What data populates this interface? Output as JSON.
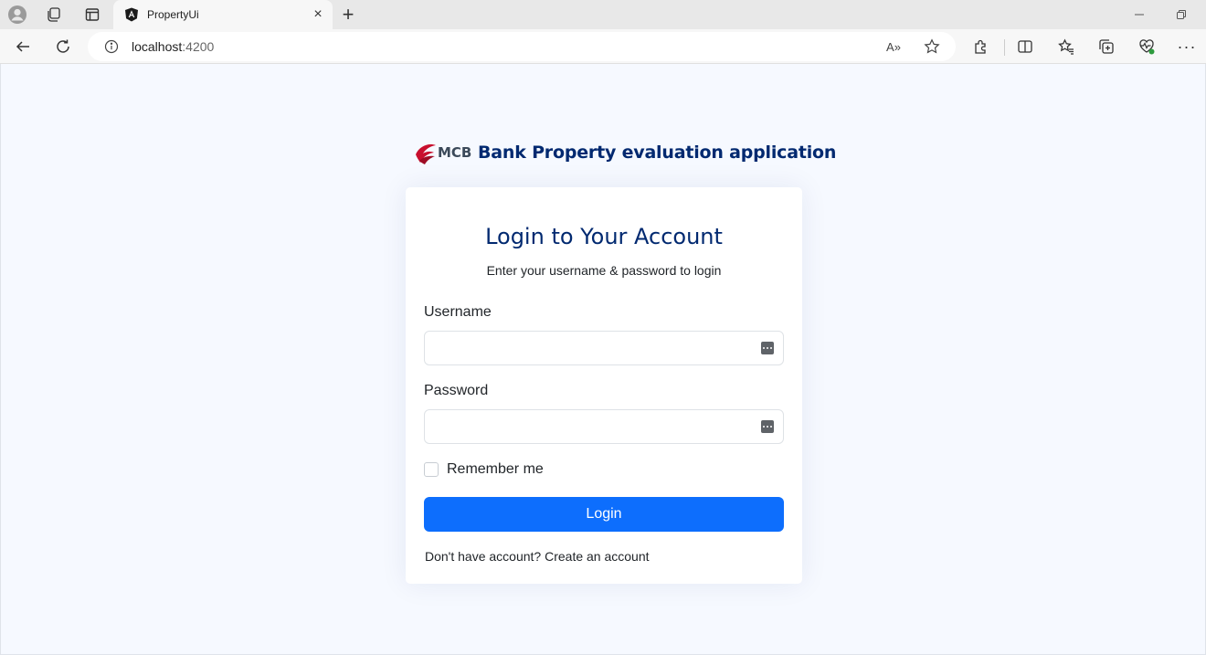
{
  "browser": {
    "tab_title": "PropertyUi",
    "tab_close": "×",
    "new_tab": "+",
    "url_host": "localhost",
    "url_port": ":4200",
    "read_aloud": "A»",
    "more": "···"
  },
  "brand": {
    "logo_text": "MCB",
    "app_title": "Bank Property evaluation application",
    "color": "#012970"
  },
  "login": {
    "title": "Login to Your Account",
    "subtitle": "Enter your username & password to login",
    "username_label": "Username",
    "username_value": "",
    "password_label": "Password",
    "password_value": "",
    "remember_label": "Remember me",
    "remember_checked": false,
    "submit_label": "Login",
    "signup_prompt": "Don't have account?",
    "signup_link": "Create an account",
    "button_color": "#0d6efd"
  }
}
